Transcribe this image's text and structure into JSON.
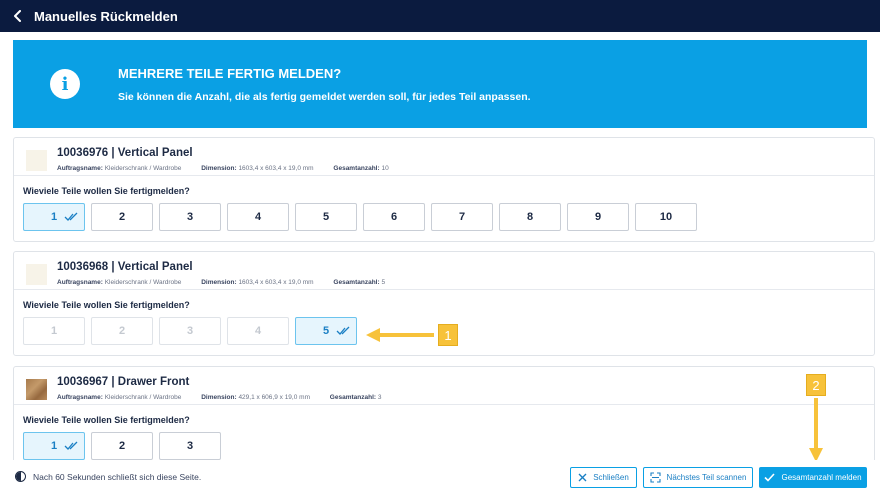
{
  "header": {
    "title": "Manuelles Rückmelden",
    "back_icon": "chevron-left-icon"
  },
  "banner": {
    "title": "MEHRERE TEILE FERTIG MELDEN?",
    "subtitle": "Sie können die Anzahl, die als fertig gemeldet werden soll, für jedes Teil anpassen.",
    "icon": "info-icon",
    "icon_glyph": "i"
  },
  "labels": {
    "order_name": "Auftragsname:",
    "dimension": "Dimension:",
    "total": "Gesamtanzahl:",
    "question": "Wieviele Teile wollen Sie fertigmelden?"
  },
  "parts": [
    {
      "title": "10036976 | Vertical Panel",
      "order_name": "Kleiderschrank / Wardrobe",
      "dimension": "1603,4 x 603,4 x 19,0 mm",
      "total": "10",
      "options": [
        "1",
        "2",
        "3",
        "4",
        "5",
        "6",
        "7",
        "8",
        "9",
        "10"
      ],
      "selected": "1",
      "disabled": []
    },
    {
      "title": "10036968 | Vertical Panel",
      "order_name": "Kleiderschrank / Wardrobe",
      "dimension": "1603,4 x 603,4 x 19,0 mm",
      "total": "5",
      "options": [
        "1",
        "2",
        "3",
        "4",
        "5"
      ],
      "selected": "5",
      "disabled": [
        "1",
        "2",
        "3",
        "4"
      ]
    },
    {
      "title": "10036967 | Drawer Front",
      "order_name": "Kleiderschrank / Wardrobe",
      "dimension": "429,1 x 606,9 x 19,0 mm",
      "total": "3",
      "options": [
        "1",
        "2",
        "3"
      ],
      "selected": "1",
      "disabled": []
    }
  ],
  "footer": {
    "timer_text": "Nach 60 Sekunden schließt sich diese Seite.",
    "close_label": "Schließen",
    "next_scan_label": "Nächstes Teil scannen",
    "report_total_label": "Gesamtanzahl melden"
  },
  "annotations": {
    "callout_1": "1",
    "callout_2": "2"
  },
  "colors": {
    "header_bg": "#0b1b3f",
    "accent": "#0aa0e4",
    "callout": "#f7c23a"
  }
}
